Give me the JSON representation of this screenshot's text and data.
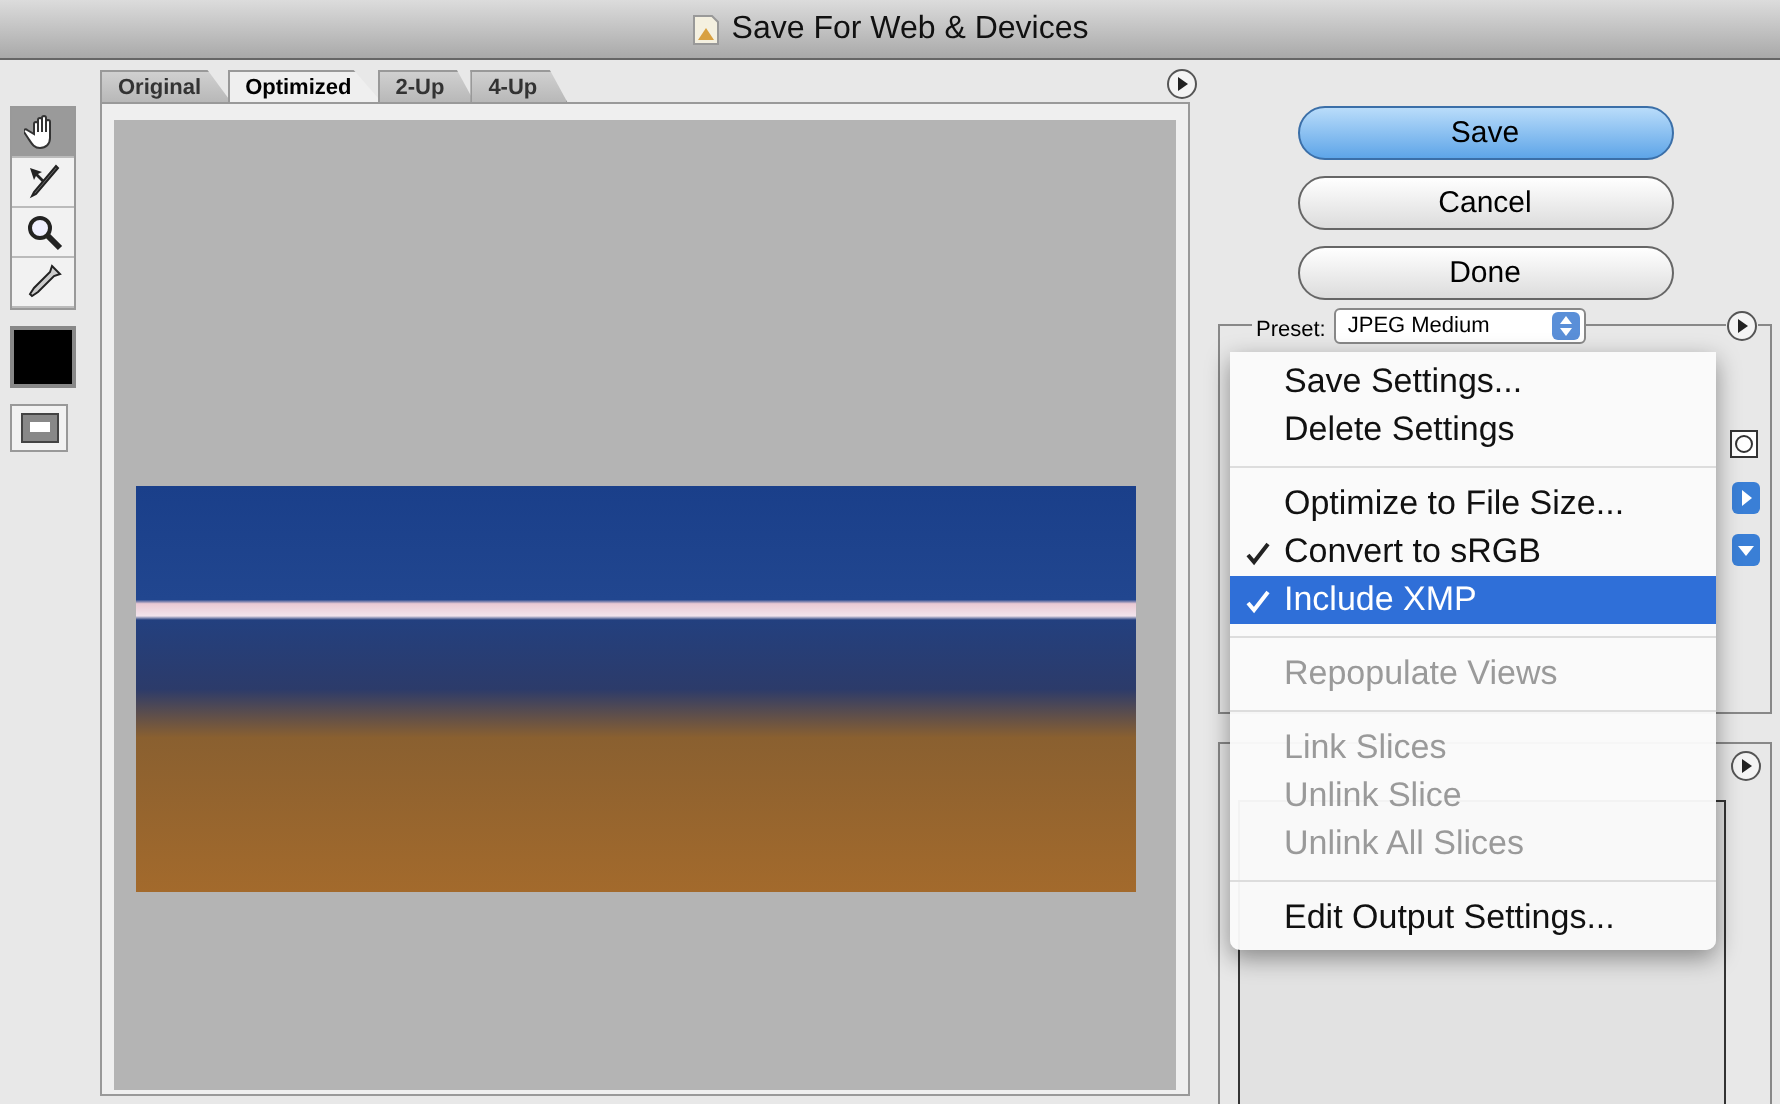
{
  "window": {
    "title": "Save For Web & Devices"
  },
  "tabs": [
    {
      "label": "Original",
      "selected": false
    },
    {
      "label": "Optimized",
      "selected": true
    },
    {
      "label": "2-Up",
      "selected": false
    },
    {
      "label": "4-Up",
      "selected": false
    }
  ],
  "buttons": [
    {
      "label": "Save",
      "selected": true
    },
    {
      "label": "Cancel",
      "selected": false
    },
    {
      "label": "Done",
      "selected": false
    }
  ],
  "preset": {
    "label": "Preset:",
    "value": "JPEG Medium"
  },
  "menu": {
    "groups": [
      [
        {
          "label": "Save Settings...",
          "checked": false,
          "disabled": false,
          "selected": false
        },
        {
          "label": "Delete Settings",
          "checked": false,
          "disabled": false,
          "selected": false
        }
      ],
      [
        {
          "label": "Optimize to File Size...",
          "checked": false,
          "disabled": false,
          "selected": false
        },
        {
          "label": "Convert to sRGB",
          "checked": true,
          "disabled": false,
          "selected": false
        },
        {
          "label": "Include XMP",
          "checked": true,
          "disabled": false,
          "selected": true
        }
      ],
      [
        {
          "label": "Repopulate Views",
          "checked": false,
          "disabled": true,
          "selected": false
        }
      ],
      [
        {
          "label": "Link Slices",
          "checked": false,
          "disabled": true,
          "selected": false
        },
        {
          "label": "Unlink Slice",
          "checked": false,
          "disabled": true,
          "selected": false
        },
        {
          "label": "Unlink All Slices",
          "checked": false,
          "disabled": true,
          "selected": false
        }
      ],
      [
        {
          "label": "Edit Output Settings...",
          "checked": false,
          "disabled": false,
          "selected": false
        }
      ]
    ]
  }
}
